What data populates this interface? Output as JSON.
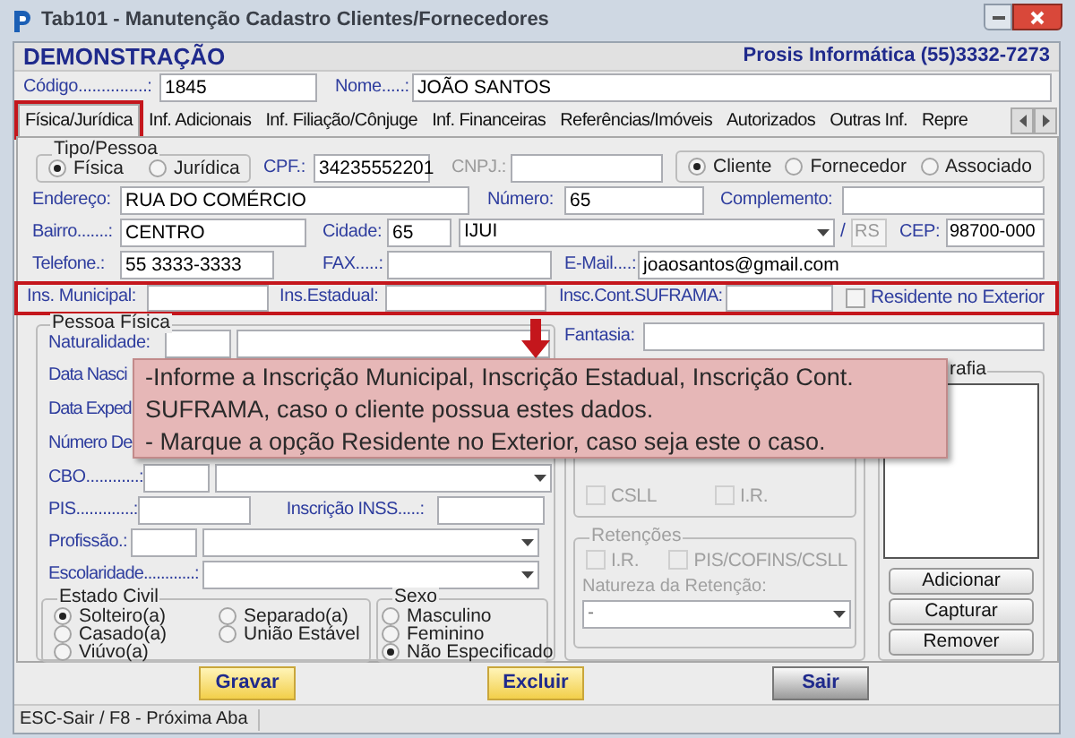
{
  "window": {
    "title": "Tab101 - Manutenção Cadastro Clientes/Fornecedores"
  },
  "header": {
    "company": "DEMONSTRAÇÃO",
    "contact": "Prosis Informática (55)3332-7273"
  },
  "codigo": {
    "label": "Código...............:",
    "value": "1845"
  },
  "nome": {
    "label": "Nome.....:",
    "value": "JOÃO SANTOS"
  },
  "tabs": [
    {
      "label": "Física/Jurídica",
      "selected": true,
      "highlighted": true
    },
    {
      "label": "Inf. Adicionais",
      "selected": false,
      "highlighted": false
    },
    {
      "label": "Inf. Filiação/Cônjuge",
      "selected": false,
      "highlighted": false
    },
    {
      "label": "Inf. Financeiras",
      "selected": false,
      "highlighted": false
    },
    {
      "label": "Referências/Imóveis",
      "selected": false,
      "highlighted": false
    },
    {
      "label": "Autorizados",
      "selected": false,
      "highlighted": false
    },
    {
      "label": "Outras Inf.",
      "selected": false,
      "highlighted": false
    },
    {
      "label": "Repre",
      "selected": false,
      "highlighted": false
    }
  ],
  "tipo_pessoa": {
    "title": "Tipo/Pessoa",
    "options": [
      {
        "label": "Física",
        "selected": true
      },
      {
        "label": "Jurídica",
        "selected": false
      }
    ]
  },
  "cpf": {
    "label": "CPF.:",
    "value": "34235552201"
  },
  "cnpj": {
    "label": "CNPJ.:",
    "disabled": true
  },
  "categoria": [
    {
      "label": "Cliente",
      "selected": true
    },
    {
      "label": "Fornecedor",
      "selected": false
    },
    {
      "label": "Associado",
      "selected": false
    }
  ],
  "endereco": {
    "label": "Endereço:",
    "value": "RUA DO COMÉRCIO"
  },
  "numero": {
    "label": "Número:",
    "value": "65"
  },
  "complemento": {
    "label": "Complemento:"
  },
  "bairro": {
    "label": "Bairro.......:",
    "value": "CENTRO"
  },
  "cidade": {
    "label": "Cidade:",
    "code": "65",
    "name": "IJUI",
    "separator": "/",
    "uf": {
      "value": "RS",
      "disabled": true
    }
  },
  "cep": {
    "label": "CEP:",
    "value": "98700-000"
  },
  "telefone": {
    "label": "Telefone.:",
    "value": "55 3333-3333"
  },
  "fax": {
    "label": "FAX.....:"
  },
  "email": {
    "label": "E-Mail....:",
    "value": "joaosantos@gmail.com"
  },
  "inscricoes": {
    "highlighted": true,
    "municipal": "Ins. Municipal:",
    "estadual": "Ins.Estadual:",
    "suframa": "Insc.Cont.SUFRAMA:",
    "residente": {
      "label": "Residente no Exterior",
      "checked": false
    }
  },
  "pessoa_fisica": {
    "title": "Pessoa Física",
    "naturalidade": "Naturalidade:",
    "data_nascimento": "Data Nasci",
    "data_expedicao": "Data Exped",
    "numero_documento": "Número De",
    "cbo": "CBO............:",
    "pis": "PIS.............:",
    "inss": "Inscrição INSS.....:",
    "profissao": "Profissão.:",
    "escolaridade": "Escolaridade............:",
    "estado_civil": {
      "title": "Estado Civil",
      "options": [
        {
          "label": "Solteiro(a)",
          "selected": true
        },
        {
          "label": "Casado(a)",
          "selected": false
        },
        {
          "label": "Viúvo(a)",
          "selected": false
        },
        {
          "label": "Separado(a)",
          "selected": false
        },
        {
          "label": "União Estável",
          "selected": false
        }
      ]
    },
    "sexo": {
      "title": "Sexo",
      "options": [
        {
          "label": "Masculino",
          "selected": false
        },
        {
          "label": "Feminino",
          "selected": false
        },
        {
          "label": "Não Especificado",
          "selected": true
        }
      ]
    }
  },
  "fantasia": {
    "label": "Fantasia:"
  },
  "tributacao": {
    "disabled": true,
    "checks": [
      {
        "label": "CSLL",
        "checked": false
      },
      {
        "label": "I.R.",
        "checked": false
      }
    ],
    "retencoes": {
      "title": "Retenções",
      "checks": [
        {
          "label": "I.R.",
          "checked": false
        },
        {
          "label": "PIS/COFINS/CSLL",
          "checked": false
        }
      ],
      "natureza_label": "Natureza da Retenção:",
      "natureza_value": "-"
    }
  },
  "fotografia": {
    "title": "rafia",
    "buttons": [
      "Adicionar",
      "Capturar",
      "Remover"
    ]
  },
  "callout": {
    "paragraphs": [
      "-Informe a Inscrição Municipal, Inscrição Estadual, Inscrição Cont. SUFRAMA, caso o cliente possua estes dados.",
      "- Marque a opção Residente no Exterior, caso seja este o caso."
    ]
  },
  "buttons": [
    {
      "label": "Gravar",
      "kind": "action"
    },
    {
      "label": "Excluir",
      "kind": "action"
    },
    {
      "label": "Sair",
      "kind": "exit"
    }
  ],
  "status_bar": "ESC-Sair / F8 - Próxima Aba"
}
